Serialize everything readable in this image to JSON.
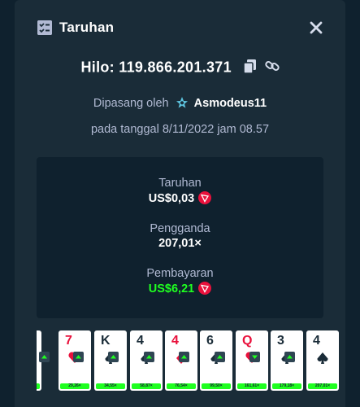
{
  "header": {
    "title": "Taruhan",
    "icon": "bet-slip-icon"
  },
  "game": {
    "label": "Hilo: 119.866.201.371",
    "placed_by_text": "Dipasang oleh",
    "username": "Asmodeus11",
    "date_text": "pada tanggal 8/11/2022 jam 08.57"
  },
  "stats": {
    "bet_label": "Taruhan",
    "bet_value": "US$0,03",
    "multiplier_label": "Pengganda",
    "multiplier_value": "207,01×",
    "payout_label": "Pembayaran",
    "payout_value": "US$6,21"
  },
  "cards": [
    {
      "rank": "",
      "suit": "heart",
      "mult": ""
    },
    {
      "rank": "7",
      "suit": "heart",
      "mult": "29,26×"
    },
    {
      "rank": "K",
      "suit": "spade",
      "mult": "34,55×"
    },
    {
      "rank": "4",
      "suit": "spade",
      "mult": "58,87×"
    },
    {
      "rank": "4",
      "suit": "diamond",
      "mult": "76,54×"
    },
    {
      "rank": "6",
      "suit": "spade",
      "mult": "99,50×"
    },
    {
      "rank": "Q",
      "suit": "heart",
      "mult": "161,61×"
    },
    {
      "rank": "3",
      "suit": "spade",
      "mult": "179,18×"
    },
    {
      "rank": "4",
      "suit": "spade",
      "mult": "207,01×"
    }
  ],
  "colors": {
    "background": "#0f212e",
    "panel": "#1a2c38",
    "muted_text": "#b1bad3",
    "payout_green": "#1fff20",
    "coin_red": "#e9113c"
  }
}
